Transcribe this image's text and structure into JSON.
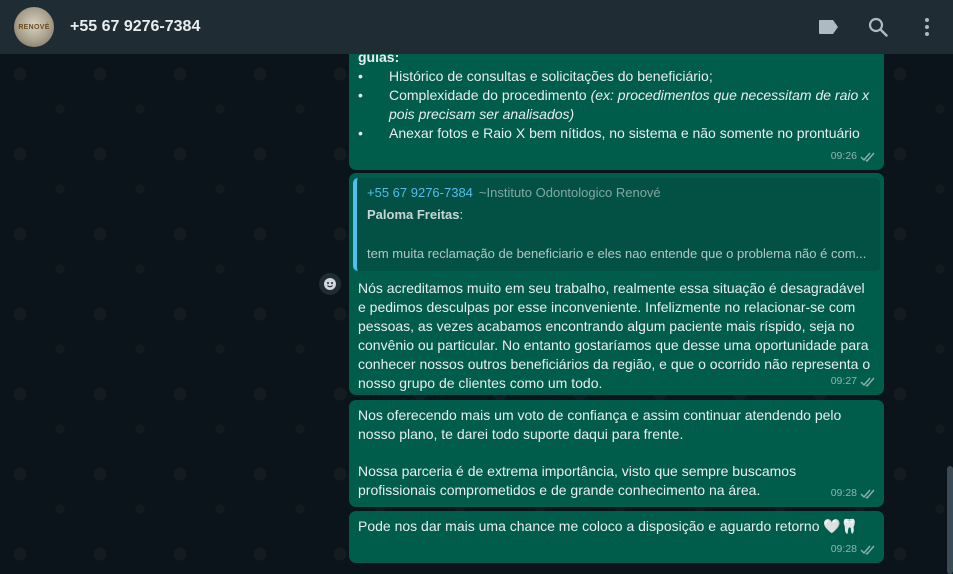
{
  "header": {
    "avatar_text": "RENOVÉ",
    "title": "+55 67 9276-7384",
    "icons": [
      "label-icon",
      "search-icon",
      "more-vert-icon"
    ]
  },
  "messages": [
    {
      "lead": "guias:",
      "bullets": [
        {
          "marker": "•",
          "text": "Histórico de consultas e solicitações do beneficiário;"
        },
        {
          "marker": "•",
          "text": "Complexidade do procedimento ",
          "italic": "(ex: procedimentos que necessitam de raio x pois precisam ser analisados)"
        },
        {
          "marker": "•",
          "text": "Anexar fotos e Raio X bem nítidos, no sistema e não somente no prontuário"
        }
      ],
      "time": "09:26"
    },
    {
      "quote": {
        "phone": "+55 67 9276-7384",
        "sender": "~Instituto Odontologico Renové",
        "author": "Paloma Freitas",
        "author_suffix": ":",
        "text": "tem muita reclamação de beneficiario e eles nao entende que o problema não é com..."
      },
      "text": "Nós acreditamos muito em seu trabalho, realmente essa situação é desagradável e pedimos desculpas por esse inconveniente. Infelizmente no relacionar-se com pessoas, as vezes acabamos encontrando algum paciente mais ríspido, seja no convênio ou particular. No entanto gostaríamos que desse uma oportunidade para conhecer nossos outros beneficiários da região, e que o ocorrido não representa o nosso grupo de clientes como um todo.",
      "time": "09:27"
    },
    {
      "text1": "Nos oferecendo mais um voto de confiança e assim continuar atendendo pelo nosso plano, te darei todo suporte daqui para frente.",
      "text2": "Nossa parceria é de extrema importância, visto que sempre buscamos profissionais comprometidos e de grande conhecimento na área.",
      "time": "09:28"
    },
    {
      "text": "Pode nos dar mais uma chance me coloco a disposição e aguardo retorno 🤍🦷",
      "time": "09:28"
    }
  ],
  "colors": {
    "header_bg": "#202c33",
    "chat_bg": "#0b141a",
    "outgoing_bubble": "#005c4b",
    "quote_accent": "#53bdeb"
  }
}
